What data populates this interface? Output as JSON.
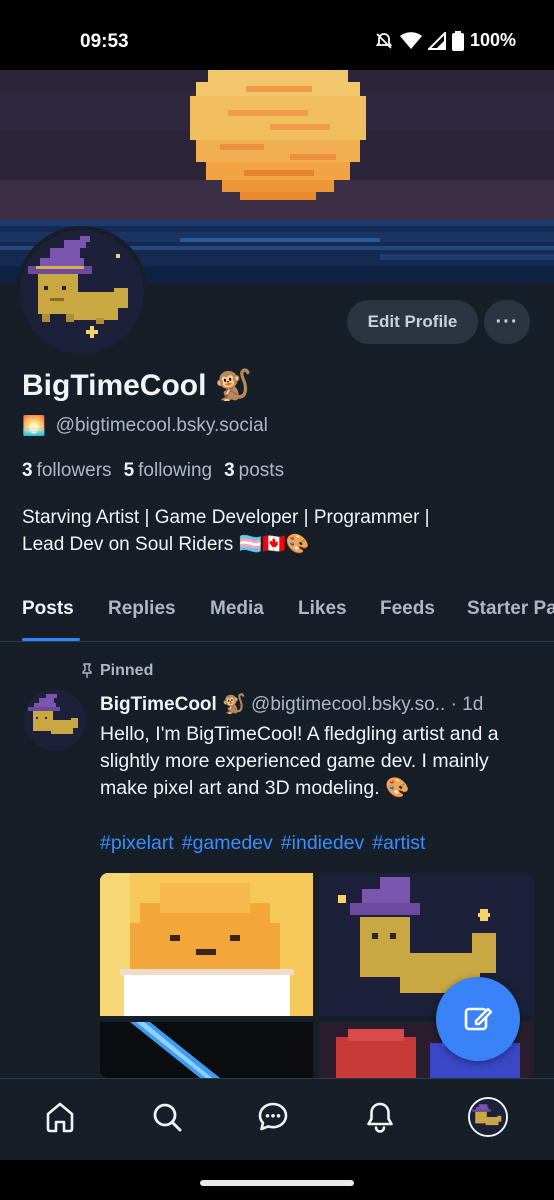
{
  "status_bar": {
    "time": "09:53",
    "battery": "100%"
  },
  "profile": {
    "display_name": "BigTimeCool 🐒",
    "handle_emoji": "🌅",
    "handle": "@bigtimecool.bsky.social",
    "edit_label": "Edit Profile",
    "more_label": "···",
    "stats": [
      {
        "count": "3",
        "label": "followers"
      },
      {
        "count": "5",
        "label": "following"
      },
      {
        "count": "3",
        "label": "posts"
      }
    ],
    "bio_line1": "Starving Artist | Game Developer | Programmer |",
    "bio_line2": "Lead Dev on Soul Riders 🏳️‍⚧️🇨🇦🎨"
  },
  "tabs": [
    "Posts",
    "Replies",
    "Media",
    "Likes",
    "Feeds",
    "Starter Packs"
  ],
  "post": {
    "pinned_label": "Pinned",
    "author_name": "BigTimeCool 🐒",
    "author_handle": "@bigtimecool.bsky.so..",
    "separator": "·",
    "time": "1d",
    "text": "Hello, I'm BigTimeCool! A fledgling artist and a slightly more experienced game dev. I mainly make pixel art and 3D modeling. 🎨",
    "tags": [
      "#pixelart",
      "#gamedev",
      "#indiedev",
      "#artist"
    ]
  },
  "nav": {
    "items": [
      "home-icon",
      "search-icon",
      "chat-icon",
      "notifications-icon",
      "profile-avatar"
    ]
  },
  "colors": {
    "background": "#161e27",
    "accent": "#2f86ff",
    "link": "#3b8cff",
    "fab": "#3a82f7",
    "muted_text": "#aeb7c2"
  }
}
